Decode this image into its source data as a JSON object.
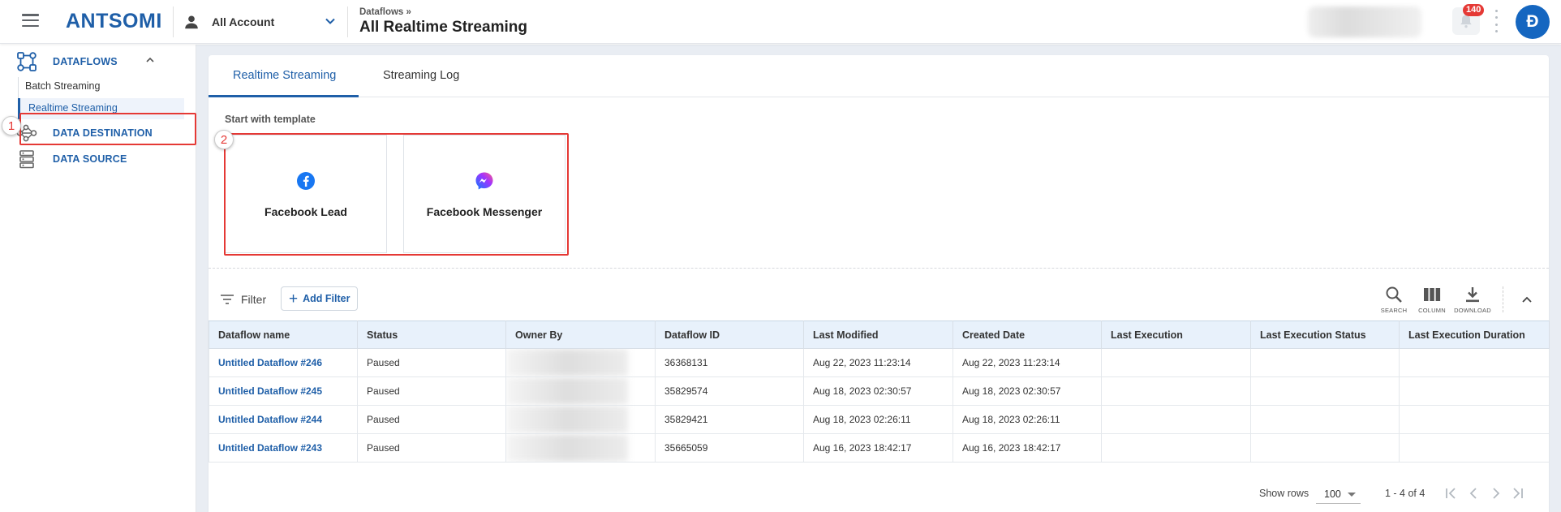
{
  "header": {
    "logo": "ANTSOMI",
    "account_label": "All Account",
    "breadcrumb": "Dataflows »",
    "page_title": "All Realtime Streaming",
    "notification_count": "140",
    "avatar_initial": "Đ"
  },
  "sidebar": {
    "sections": [
      {
        "label": "DATAFLOWS",
        "icon": "dataflows-icon"
      },
      {
        "label": "DATA DESTINATION",
        "icon": "data-destination-icon"
      },
      {
        "label": "DATA SOURCE",
        "icon": "data-source-icon"
      }
    ],
    "sub_items": [
      {
        "label": "Batch Streaming"
      },
      {
        "label": "Realtime Streaming",
        "active": true
      }
    ]
  },
  "annotations": [
    "1",
    "2"
  ],
  "tabs": [
    {
      "label": "Realtime Streaming",
      "active": true
    },
    {
      "label": "Streaming Log",
      "active": false
    }
  ],
  "templates": {
    "title": "Start with template",
    "items": [
      {
        "label": "Facebook Lead",
        "icon": "facebook-icon"
      },
      {
        "label": "Facebook Messenger",
        "icon": "messenger-icon"
      }
    ]
  },
  "toolbar": {
    "filter_label": "Filter",
    "add_filter_label": "Add Filter",
    "tools": [
      "SEARCH",
      "COLUMN",
      "DOWNLOAD"
    ]
  },
  "table": {
    "columns": [
      "Dataflow name",
      "Status",
      "Owner By",
      "Dataflow ID",
      "Last Modified",
      "Created Date",
      "Last Execution",
      "Last Execution Status",
      "Last Execution Duration"
    ],
    "rows": [
      [
        "Untitled Dataflow #246",
        "Paused",
        "",
        "36368131",
        "Aug 22, 2023 11:23:14",
        "Aug 22, 2023 11:23:14",
        "",
        "",
        ""
      ],
      [
        "Untitled Dataflow #245",
        "Paused",
        "",
        "35829574",
        "Aug 18, 2023 02:30:57",
        "Aug 18, 2023 02:30:57",
        "",
        "",
        ""
      ],
      [
        "Untitled Dataflow #244",
        "Paused",
        "",
        "35829421",
        "Aug 18, 2023 02:26:11",
        "Aug 18, 2023 02:26:11",
        "",
        "",
        ""
      ],
      [
        "Untitled Dataflow #243",
        "Paused",
        "",
        "35665059",
        "Aug 16, 2023 18:42:17",
        "Aug 16, 2023 18:42:17",
        "",
        "",
        ""
      ]
    ]
  },
  "pagination": {
    "rows_label": "Show rows",
    "rows_value": "100",
    "range": "1 - 4 of 4"
  },
  "colors": {
    "brand": "#1f5fa8",
    "annotation": "#e53935",
    "header_row": "#e8f1fb",
    "facebook": "#1877f2"
  }
}
